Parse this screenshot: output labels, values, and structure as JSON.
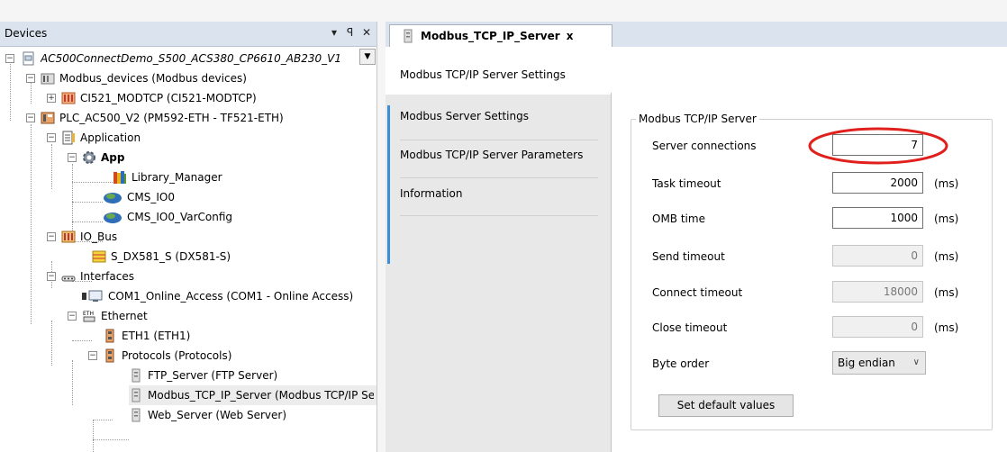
{
  "devices_panel": {
    "title": "Devices",
    "pin": "ꟼ",
    "close": "✕",
    "menu": "▾",
    "dropdown_arrow": "▼"
  },
  "tree": [
    {
      "label": "AC500ConnectDemo_S500_ACS380_CP6610_AB230_V1",
      "icon": "project-icon",
      "style": "italic"
    },
    {
      "label": "Modbus_devices (Modbus devices)",
      "icon": "device-folder-icon"
    },
    {
      "label": "CI521_MODTCP (CI521-MODTCP)",
      "icon": "module-icon"
    },
    {
      "label": "PLC_AC500_V2 (PM592-ETH - TF521-ETH)",
      "icon": "plc-icon"
    },
    {
      "label": "Application",
      "icon": "application-icon"
    },
    {
      "label": "App",
      "icon": "gear-icon",
      "style": "bold"
    },
    {
      "label": "Library_Manager",
      "icon": "library-icon"
    },
    {
      "label": "CMS_IO0",
      "icon": "globe-icon"
    },
    {
      "label": "CMS_IO0_VarConfig",
      "icon": "globe-icon"
    },
    {
      "label": "IO_Bus",
      "icon": "bus-icon"
    },
    {
      "label": "S_DX581_S (DX581-S)",
      "icon": "io-module-icon"
    },
    {
      "label": "Interfaces",
      "icon": "interfaces-icon"
    },
    {
      "label": "COM1_Online_Access (COM1 - Online Access)",
      "icon": "serial-port-icon"
    },
    {
      "label": "Ethernet",
      "icon": "ethernet-icon"
    },
    {
      "label": "ETH1 (ETH1)",
      "icon": "eth-port-icon"
    },
    {
      "label": "Protocols (Protocols)",
      "icon": "protocols-icon"
    },
    {
      "label": "FTP_Server (FTP Server)",
      "icon": "server-icon"
    },
    {
      "label": "Modbus_TCP_IP_Server (Modbus TCP/IP Server)",
      "icon": "server-icon"
    },
    {
      "label": "Web_Server (Web Server)",
      "icon": "server-icon"
    }
  ],
  "editor_tab": {
    "label": "Modbus_TCP_IP_Server",
    "close": "x"
  },
  "vtabs": [
    {
      "label": "Modbus TCP/IP Server Settings",
      "active": true
    },
    {
      "label": "Modbus Server Settings"
    },
    {
      "label": "Modbus TCP/IP Server Parameters"
    },
    {
      "label": "Information"
    }
  ],
  "settings": {
    "group_title": "Modbus TCP/IP Server",
    "rows": [
      {
        "label": "Server connections",
        "value": "7",
        "unit": "",
        "disabled": false
      },
      {
        "label": "Task timeout",
        "value": "2000",
        "unit": "(ms)",
        "disabled": false
      },
      {
        "label": "OMB time",
        "value": "1000",
        "unit": "(ms)",
        "disabled": false
      },
      {
        "label": "Send timeout",
        "value": "0",
        "unit": "(ms)",
        "disabled": true
      },
      {
        "label": "Connect timeout",
        "value": "18000",
        "unit": "(ms)",
        "disabled": true
      },
      {
        "label": "Close timeout",
        "value": "0",
        "unit": "(ms)",
        "disabled": true
      }
    ],
    "byte_order": {
      "label": "Byte order",
      "value": "Big endian"
    },
    "default_button": "Set default values"
  },
  "colors": {
    "highlight": "#e0201c",
    "accent": "#3a8fd6"
  }
}
